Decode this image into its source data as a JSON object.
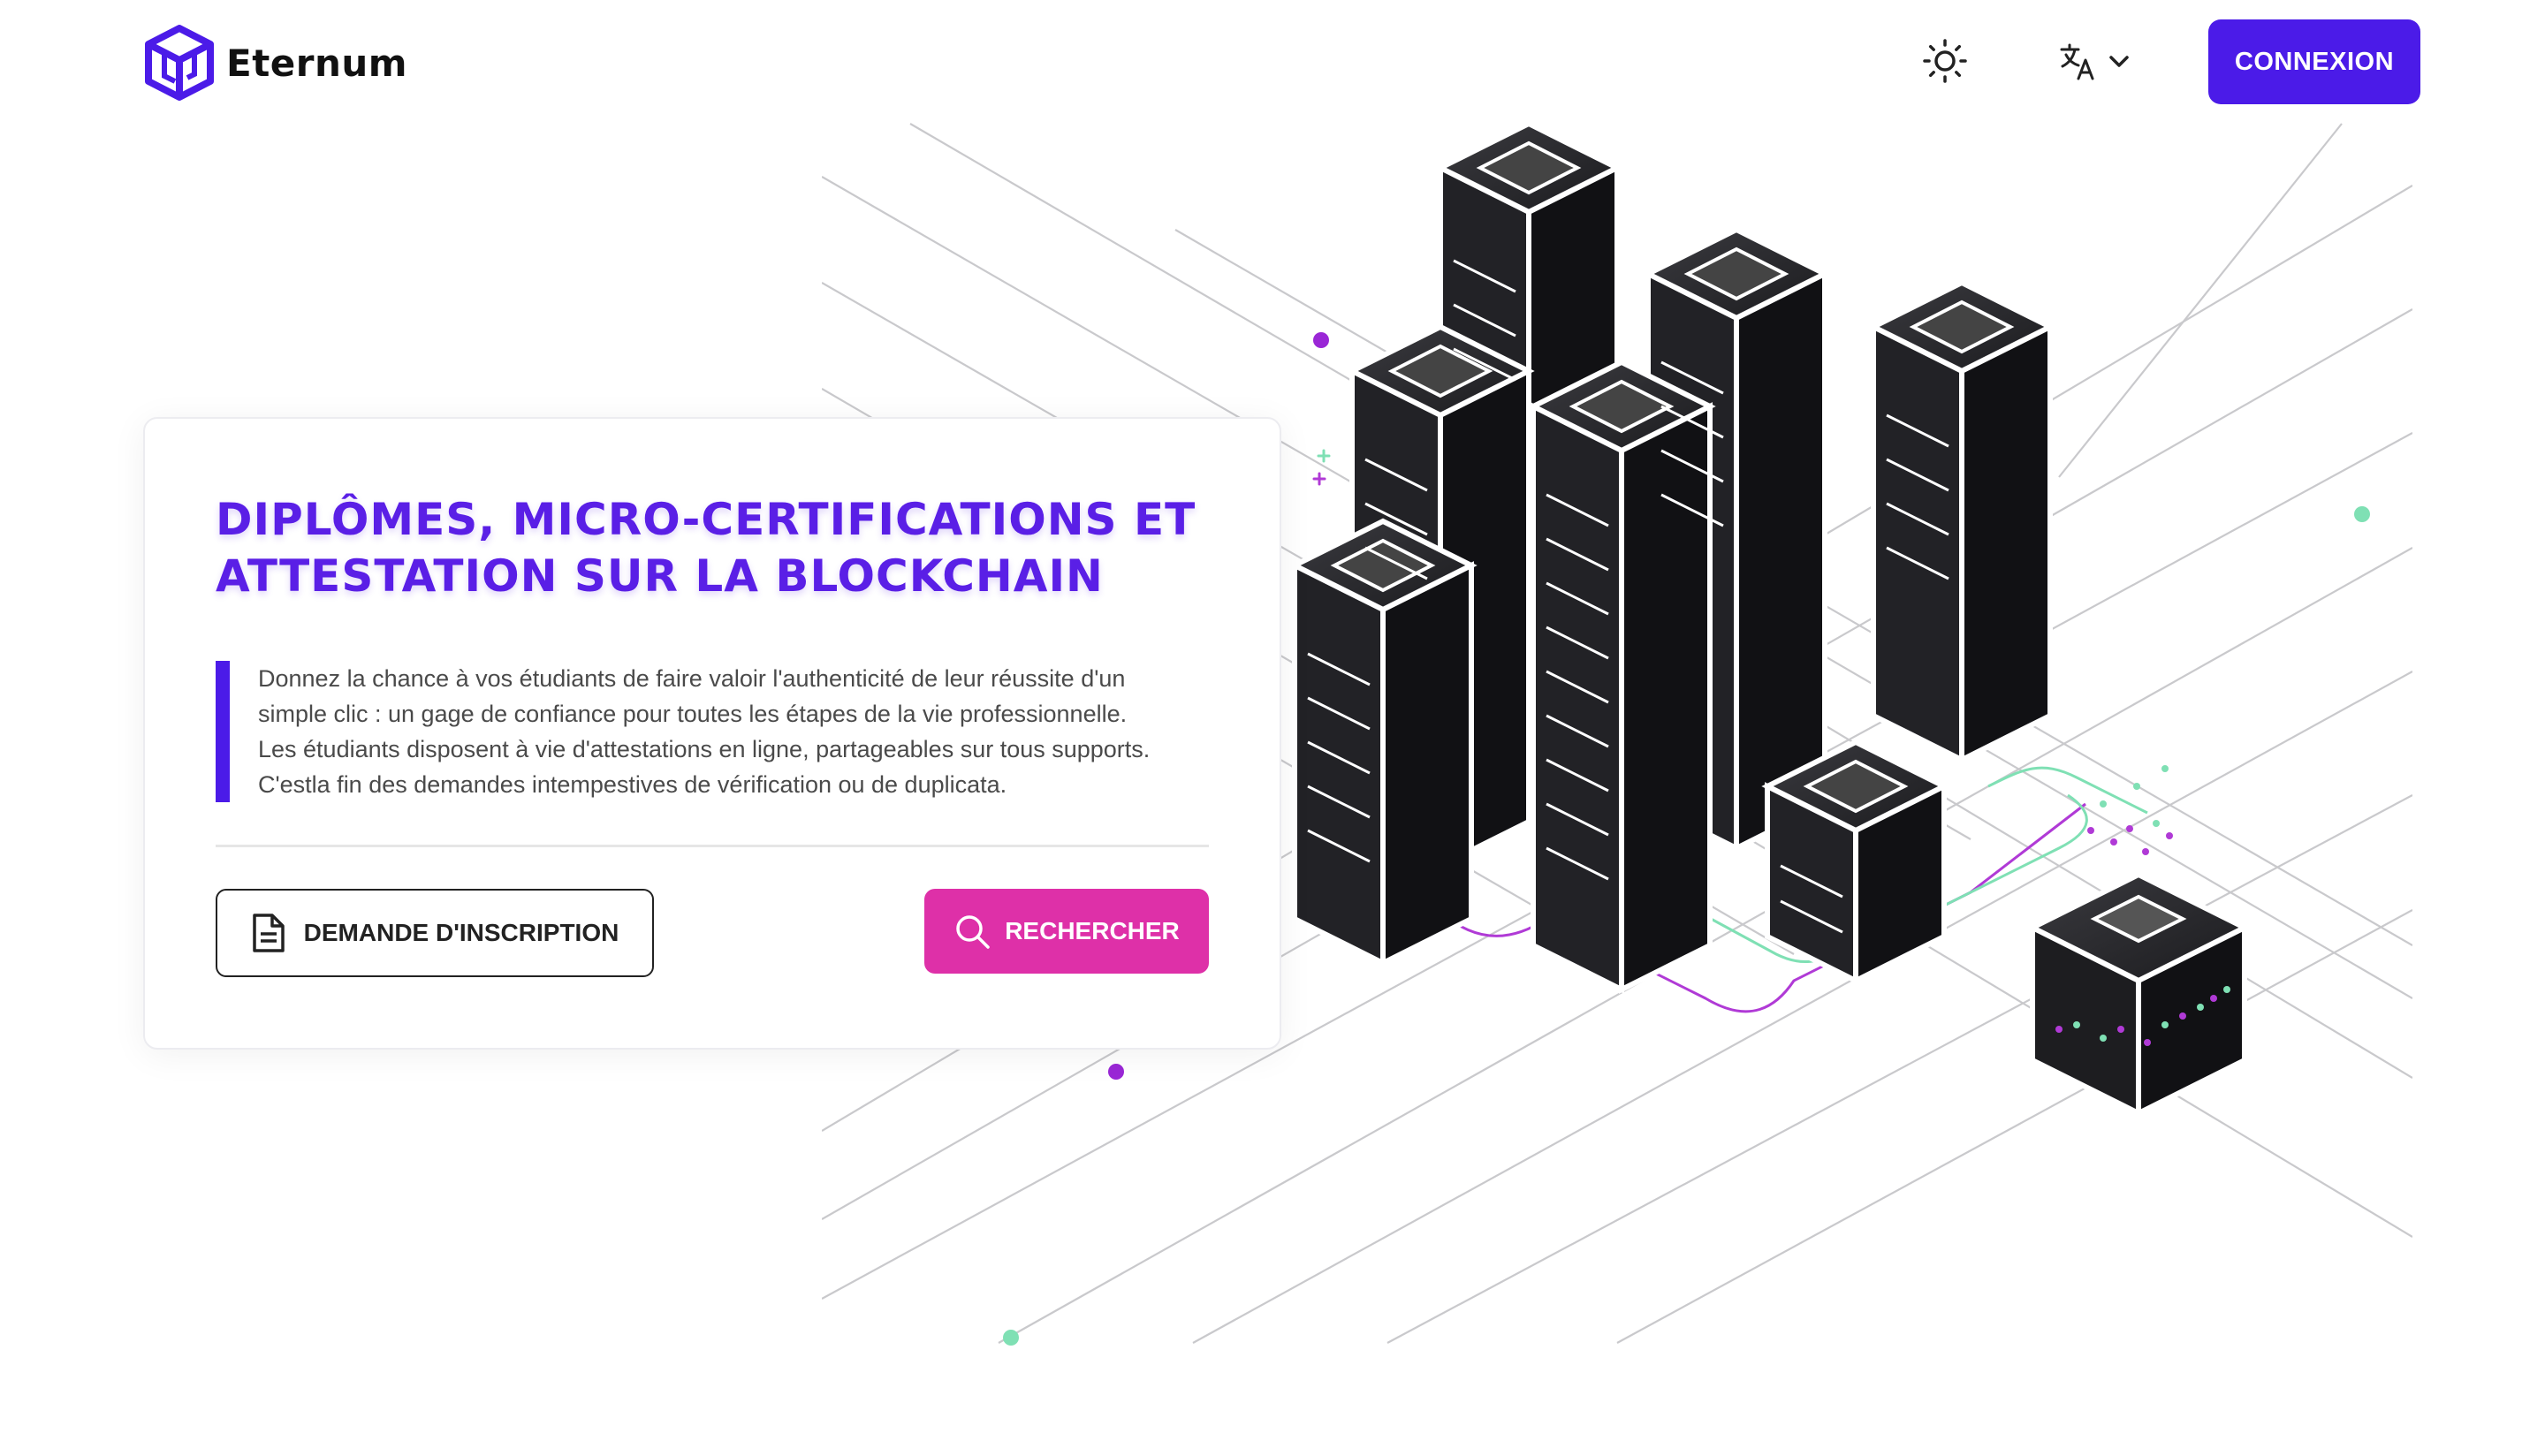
{
  "brand": {
    "name": "Eternum",
    "accent": "#4b1be8",
    "pink": "#de30a8"
  },
  "header": {
    "theme_icon": "sun-icon",
    "language_icon": "translate-icon",
    "login_label": "CONNEXION"
  },
  "hero": {
    "title_line1": "DIPLÔMES, MICRO-CERTIFICATIONS ET",
    "title_line2": "ATTESTATION SUR LA BLOCKCHAIN",
    "description": [
      "Donnez la chance à vos étudiants de faire valoir l'authenticité de leur réussite d'un",
      "simple clic : un gage de confiance pour toutes les étapes de la vie professionnelle.",
      "Les étudiants disposent à vie d'attestations en ligne, partageables sur tous supports.",
      "C'estla fin des demandes intempestives de vérification ou de duplicata."
    ],
    "enroll_label": "DEMANDE D'INSCRIPTION",
    "enroll_icon": "document-icon",
    "search_label": "RECHERCHER",
    "search_icon": "search-icon"
  },
  "illustration": {
    "subject": "server-racks-blockchain-illustration"
  }
}
